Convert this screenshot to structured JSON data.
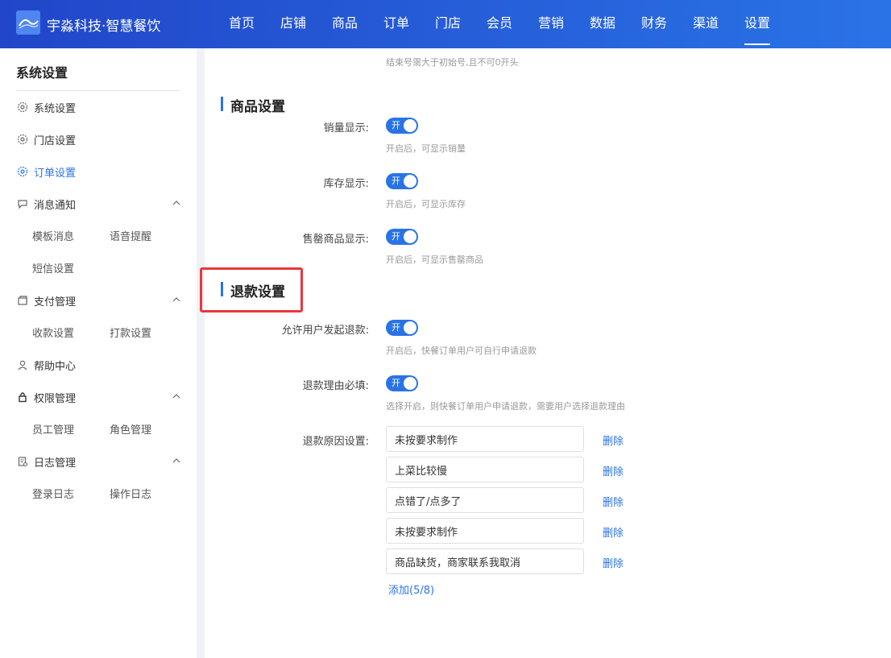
{
  "header": {
    "brand": "宇淼科技·智慧餐饮",
    "nav": [
      "首页",
      "店铺",
      "商品",
      "订单",
      "门店",
      "会员",
      "营销",
      "数据",
      "财务",
      "渠道",
      "设置"
    ],
    "active_nav": "设置"
  },
  "sidebar": {
    "title": "系统设置",
    "items": [
      {
        "label": "系统设置",
        "icon": "gear-icon"
      },
      {
        "label": "门店设置",
        "icon": "gear-icon"
      },
      {
        "label": "订单设置",
        "icon": "gear-icon",
        "active": true
      },
      {
        "label": "消息通知",
        "icon": "chat-icon",
        "subs": [
          "模板消息",
          "语音提醒",
          "短信设置"
        ]
      },
      {
        "label": "支付管理",
        "icon": "wallet-icon",
        "subs": [
          "收款设置",
          "打款设置"
        ]
      },
      {
        "label": "帮助中心",
        "icon": "user-icon"
      },
      {
        "label": "权限管理",
        "icon": "lock-icon",
        "subs": [
          "员工管理",
          "角色管理"
        ]
      },
      {
        "label": "日志管理",
        "icon": "log-icon",
        "subs": [
          "登录日志",
          "操作日志"
        ]
      }
    ]
  },
  "main": {
    "top_hint": "结束号需大于初始号,且不可0开头",
    "goods": {
      "title": "商品设置",
      "rows": [
        {
          "label": "销量显示:",
          "switch_text": "开",
          "hint": "开启后，可显示销量"
        },
        {
          "label": "库存显示:",
          "switch_text": "开",
          "hint": "开启后，可显示库存"
        },
        {
          "label": "售罄商品显示:",
          "switch_text": "开",
          "hint": "开启后，可显示售罄商品"
        }
      ]
    },
    "refund": {
      "title": "退款设置",
      "rows": [
        {
          "label": "允许用户发起退款:",
          "switch_text": "开",
          "hint": "开启后，快餐订单用户可自行申请退款"
        },
        {
          "label": "退款理由必填:",
          "switch_text": "开",
          "hint": "选择开启，则快餐订单用户申请退款，需要用户选择退款理由"
        }
      ],
      "reasons_label": "退款原因设置:",
      "reasons": [
        "未按要求制作",
        "上菜比较慢",
        "点错了/点多了",
        "未按要求制作",
        "商品缺货，商家联系我取消"
      ],
      "delete_label": "删除",
      "add_label": "添加(5/8)"
    }
  }
}
